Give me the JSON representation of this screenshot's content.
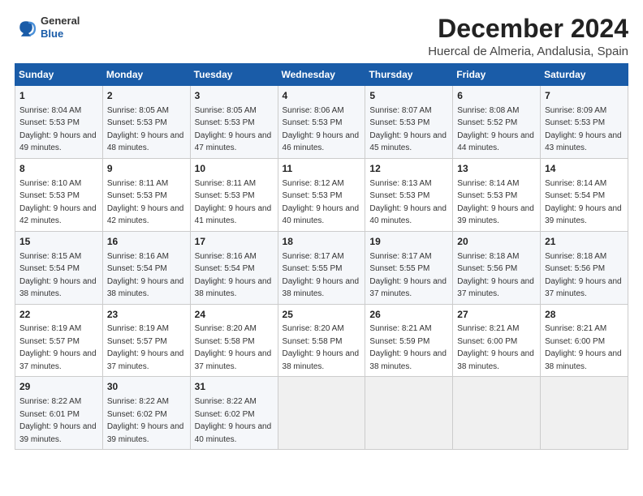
{
  "logo": {
    "line1": "General",
    "line2": "Blue"
  },
  "title": "December 2024",
  "location": "Huercal de Almeria, Andalusia, Spain",
  "headers": [
    "Sunday",
    "Monday",
    "Tuesday",
    "Wednesday",
    "Thursday",
    "Friday",
    "Saturday"
  ],
  "weeks": [
    [
      {
        "day": "1",
        "sunrise": "8:04 AM",
        "sunset": "5:53 PM",
        "daylight": "9 hours and 49 minutes."
      },
      {
        "day": "2",
        "sunrise": "8:05 AM",
        "sunset": "5:53 PM",
        "daylight": "9 hours and 48 minutes."
      },
      {
        "day": "3",
        "sunrise": "8:05 AM",
        "sunset": "5:53 PM",
        "daylight": "9 hours and 47 minutes."
      },
      {
        "day": "4",
        "sunrise": "8:06 AM",
        "sunset": "5:53 PM",
        "daylight": "9 hours and 46 minutes."
      },
      {
        "day": "5",
        "sunrise": "8:07 AM",
        "sunset": "5:53 PM",
        "daylight": "9 hours and 45 minutes."
      },
      {
        "day": "6",
        "sunrise": "8:08 AM",
        "sunset": "5:52 PM",
        "daylight": "9 hours and 44 minutes."
      },
      {
        "day": "7",
        "sunrise": "8:09 AM",
        "sunset": "5:53 PM",
        "daylight": "9 hours and 43 minutes."
      }
    ],
    [
      {
        "day": "8",
        "sunrise": "8:10 AM",
        "sunset": "5:53 PM",
        "daylight": "9 hours and 42 minutes."
      },
      {
        "day": "9",
        "sunrise": "8:11 AM",
        "sunset": "5:53 PM",
        "daylight": "9 hours and 42 minutes."
      },
      {
        "day": "10",
        "sunrise": "8:11 AM",
        "sunset": "5:53 PM",
        "daylight": "9 hours and 41 minutes."
      },
      {
        "day": "11",
        "sunrise": "8:12 AM",
        "sunset": "5:53 PM",
        "daylight": "9 hours and 40 minutes."
      },
      {
        "day": "12",
        "sunrise": "8:13 AM",
        "sunset": "5:53 PM",
        "daylight": "9 hours and 40 minutes."
      },
      {
        "day": "13",
        "sunrise": "8:14 AM",
        "sunset": "5:53 PM",
        "daylight": "9 hours and 39 minutes."
      },
      {
        "day": "14",
        "sunrise": "8:14 AM",
        "sunset": "5:54 PM",
        "daylight": "9 hours and 39 minutes."
      }
    ],
    [
      {
        "day": "15",
        "sunrise": "8:15 AM",
        "sunset": "5:54 PM",
        "daylight": "9 hours and 38 minutes."
      },
      {
        "day": "16",
        "sunrise": "8:16 AM",
        "sunset": "5:54 PM",
        "daylight": "9 hours and 38 minutes."
      },
      {
        "day": "17",
        "sunrise": "8:16 AM",
        "sunset": "5:54 PM",
        "daylight": "9 hours and 38 minutes."
      },
      {
        "day": "18",
        "sunrise": "8:17 AM",
        "sunset": "5:55 PM",
        "daylight": "9 hours and 38 minutes."
      },
      {
        "day": "19",
        "sunrise": "8:17 AM",
        "sunset": "5:55 PM",
        "daylight": "9 hours and 37 minutes."
      },
      {
        "day": "20",
        "sunrise": "8:18 AM",
        "sunset": "5:56 PM",
        "daylight": "9 hours and 37 minutes."
      },
      {
        "day": "21",
        "sunrise": "8:18 AM",
        "sunset": "5:56 PM",
        "daylight": "9 hours and 37 minutes."
      }
    ],
    [
      {
        "day": "22",
        "sunrise": "8:19 AM",
        "sunset": "5:57 PM",
        "daylight": "9 hours and 37 minutes."
      },
      {
        "day": "23",
        "sunrise": "8:19 AM",
        "sunset": "5:57 PM",
        "daylight": "9 hours and 37 minutes."
      },
      {
        "day": "24",
        "sunrise": "8:20 AM",
        "sunset": "5:58 PM",
        "daylight": "9 hours and 37 minutes."
      },
      {
        "day": "25",
        "sunrise": "8:20 AM",
        "sunset": "5:58 PM",
        "daylight": "9 hours and 38 minutes."
      },
      {
        "day": "26",
        "sunrise": "8:21 AM",
        "sunset": "5:59 PM",
        "daylight": "9 hours and 38 minutes."
      },
      {
        "day": "27",
        "sunrise": "8:21 AM",
        "sunset": "6:00 PM",
        "daylight": "9 hours and 38 minutes."
      },
      {
        "day": "28",
        "sunrise": "8:21 AM",
        "sunset": "6:00 PM",
        "daylight": "9 hours and 38 minutes."
      }
    ],
    [
      {
        "day": "29",
        "sunrise": "8:22 AM",
        "sunset": "6:01 PM",
        "daylight": "9 hours and 39 minutes."
      },
      {
        "day": "30",
        "sunrise": "8:22 AM",
        "sunset": "6:02 PM",
        "daylight": "9 hours and 39 minutes."
      },
      {
        "day": "31",
        "sunrise": "8:22 AM",
        "sunset": "6:02 PM",
        "daylight": "9 hours and 40 minutes."
      },
      null,
      null,
      null,
      null
    ]
  ]
}
